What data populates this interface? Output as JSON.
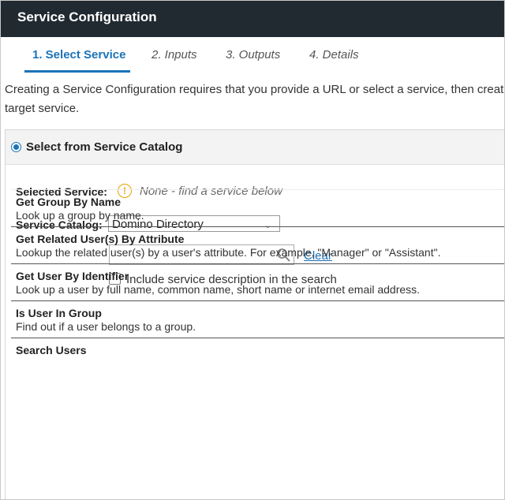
{
  "header": {
    "title": "Service Configuration"
  },
  "tabs": [
    {
      "label": "1. Select Service",
      "active": true
    },
    {
      "label": "2. Inputs",
      "active": false
    },
    {
      "label": "3. Outputs",
      "active": false
    },
    {
      "label": "4. Details",
      "active": false
    }
  ],
  "intro": {
    "line1": "Creating a Service Configuration requires that you provide a URL or select a service, then creat",
    "line2": "target service."
  },
  "catalog_panel": {
    "title": "Select from Service Catalog",
    "selected_service_label": "Selected Service:",
    "selected_service_value": "None - find a service below",
    "catalog_label": "Service Catalog:",
    "catalog_value": "Domino Directory",
    "search_value": "",
    "search_placeholder": "",
    "clear_label": "Clear",
    "include_description_label": "Include service description in the search",
    "include_description_checked": false
  },
  "services": [
    {
      "name": "Get Group By Name",
      "description": "Look up a group by name."
    },
    {
      "name": "Get Related User(s) By Attribute",
      "description": "Lookup the related user(s) by a user's attribute. For example, \"Manager\" or \"Assistant\"."
    },
    {
      "name": "Get User By Identifier",
      "description": "Look up a user by full name, common name, short name or internet email address."
    },
    {
      "name": "Is User In Group",
      "description": "Find out if a user belongs to a group."
    },
    {
      "name": "Search Users",
      "description": ""
    }
  ],
  "colors": {
    "titlebar_bg": "#212a31",
    "accent": "#1a73b8",
    "link": "#1a6fb3",
    "warning": "#e5a000"
  },
  "icons": {
    "warning": "exclamation-circle-icon",
    "search": "magnifier-icon",
    "dropdown": "chevron-down-icon"
  }
}
